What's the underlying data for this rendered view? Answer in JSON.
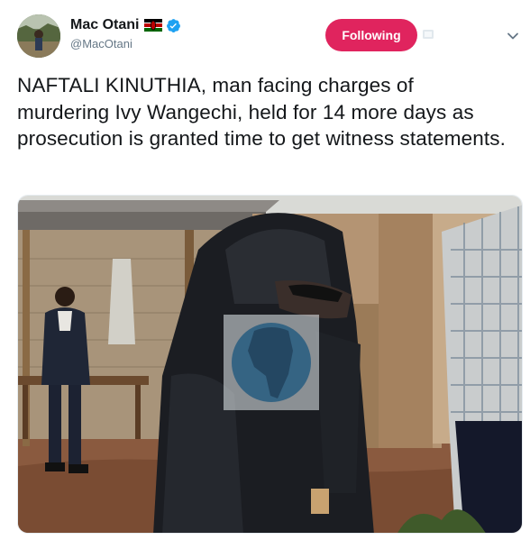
{
  "tweet": {
    "author": {
      "name": "Mac Otani",
      "handle": "@MacOtani",
      "flag_icon": "kenya-flag-icon",
      "verified_icon": "verified-badge-icon"
    },
    "follow_button": {
      "label": "Following",
      "color": "#e0245e"
    },
    "text": "NAFTALI KINUTHIA, man facing charges of murdering Ivy Wangechi, held for 14 more days as prosecution is granted time to get witness statements.",
    "media": {
      "type": "photo",
      "watermark_icon": "africa-map-watermark-icon"
    }
  },
  "colors": {
    "text": "#14171a",
    "secondary_text": "#657786",
    "verified_blue": "#1da1f2",
    "following_pink": "#e0245e"
  }
}
